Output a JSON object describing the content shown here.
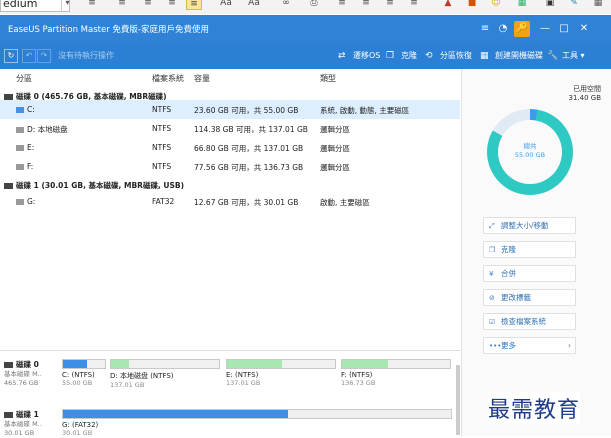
{
  "host_toolbar": {
    "font_value": "edium",
    "buttons": [
      "≡",
      "≡",
      "≡",
      "≡",
      "Aa",
      "Aa",
      "∞",
      "⎙",
      "≡",
      "≡",
      "≡",
      "≡",
      "▲",
      "■",
      "☺",
      "▦",
      "▣",
      "✎",
      "▦"
    ]
  },
  "window": {
    "title": "EaseUS Partition Master 免費版-家庭用戶免費使用",
    "controls": [
      "≡",
      "◔",
      "🔑",
      "—",
      "□",
      "✕"
    ]
  },
  "toolbar": {
    "refresh_icon": "↻",
    "undo_icon": "↶",
    "redo_icon": "↷",
    "pending_label": "沒有待執行操作",
    "actions": [
      {
        "icon": "⇄",
        "label": "遷移OS"
      },
      {
        "icon": "❐",
        "label": "克隆"
      },
      {
        "icon": "⟲",
        "label": "分區恢復"
      },
      {
        "icon": "▦",
        "label": "創建開機磁碟"
      },
      {
        "icon": "🔧",
        "label": "工具 ▾"
      }
    ]
  },
  "columns": [
    "分區",
    "檔案系統",
    "容量",
    "類型"
  ],
  "disks": [
    {
      "title": "磁碟 0 (465.76 GB, 基本磁碟, MBR磁碟)",
      "partitions": [
        {
          "name": "C:",
          "fs": "NTFS",
          "capacity": "23.60 GB  可用，共  55.00 GB",
          "type": "系統, 啟動, 動態, 主要磁區",
          "selected": true
        },
        {
          "name": "D: 本地磁盘",
          "fs": "NTFS",
          "capacity": "114.38 GB  可用，共  137.01 GB",
          "type": "邏輯分區",
          "selected": false
        },
        {
          "name": "E:",
          "fs": "NTFS",
          "capacity": "66.80 GB  可用，共  137.01 GB",
          "type": "邏輯分區",
          "selected": false
        },
        {
          "name": "F:",
          "fs": "NTFS",
          "capacity": "77.56 GB  可用，共  136.73 GB",
          "type": "邏輯分區",
          "selected": false
        }
      ]
    },
    {
      "title": "磁碟 1 (30.01 GB, 基本磁碟, MBR磁碟, USB)",
      "partitions": [
        {
          "name": "G:",
          "fs": "FAT32",
          "capacity": "12.67 GB  可用，共  30.01 GB",
          "type": "啟動, 主要磁區",
          "selected": false
        }
      ]
    }
  ],
  "usage": {
    "legend_used": "已用空間",
    "legend_value": "31.40 GB",
    "ring_label": "總共",
    "ring_value": "55.00 GB"
  },
  "operations": [
    {
      "icon": "⤢",
      "label": "調整大小/移動"
    },
    {
      "icon": "❐",
      "label": "克隆"
    },
    {
      "icon": "¥",
      "label": "合併"
    },
    {
      "icon": "⊘",
      "label": "更改標籤"
    },
    {
      "icon": "☑",
      "label": "檢查檔案系統"
    },
    {
      "icon": "•••",
      "label": "更多",
      "chevron": "›"
    }
  ],
  "disk_map": [
    {
      "name": "磁碟 0",
      "type": "基本磁碟 M..",
      "size": "465.76 GB",
      "partitions": [
        {
          "label": "C: (NTFS)",
          "size": "55.00 GB",
          "used": 0.57,
          "color": "#3b8fe8"
        },
        {
          "label": "D: 本地磁盘 (NTFS)",
          "size": "137.01 GB",
          "used": 0.17,
          "color": "#a7e8b0"
        },
        {
          "label": "E: (NTFS)",
          "size": "137.01 GB",
          "used": 0.51,
          "color": "#a7e8b0"
        },
        {
          "label": "F: (NTFS)",
          "size": "136.73 GB",
          "used": 0.43,
          "color": "#a7e8b0"
        }
      ]
    },
    {
      "name": "磁碟 1",
      "type": "基本磁碟 M..",
      "size": "30.01 GB",
      "partitions": [
        {
          "label": "G: (FAT32)",
          "size": "30.01 GB",
          "used": 0.58,
          "color": "#3b8fe8"
        }
      ]
    }
  ],
  "watermark": "最需教育"
}
